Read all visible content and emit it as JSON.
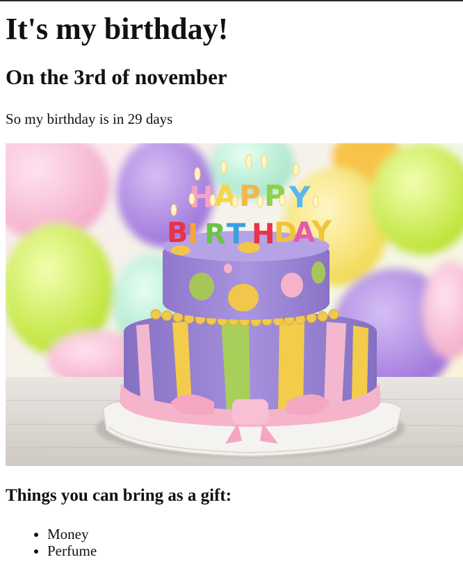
{
  "page": {
    "heading": "It's my birthday!",
    "subheading": "On the 3rd of november",
    "countdown_text": "So my birthday is in 29 days",
    "gifts_heading": "Things you can bring as a gift:"
  },
  "cake_image": {
    "candle_letters_top": [
      "H",
      "A",
      "P",
      "P",
      "Y"
    ],
    "candle_letters_bottom": [
      "B",
      "I",
      "R",
      "T",
      "H",
      "D",
      "A",
      "Y"
    ],
    "colors": {
      "sky": "#eef6ff",
      "balloon_purple": "#a47ce0",
      "balloon_green": "#c9ea3a",
      "balloon_pink": "#f4b3cf",
      "balloon_yellow": "#f7e25a",
      "cake_purple": "#9e86d6",
      "stripe_yellow": "#f2cc4a",
      "stripe_green": "#a7cf5a",
      "stripe_pink": "#f3b8cf",
      "ribbon_pink": "#f6b4cb",
      "plate": "#f3f1ee"
    }
  },
  "gifts": {
    "items": [
      "Money",
      "Perfume"
    ]
  }
}
